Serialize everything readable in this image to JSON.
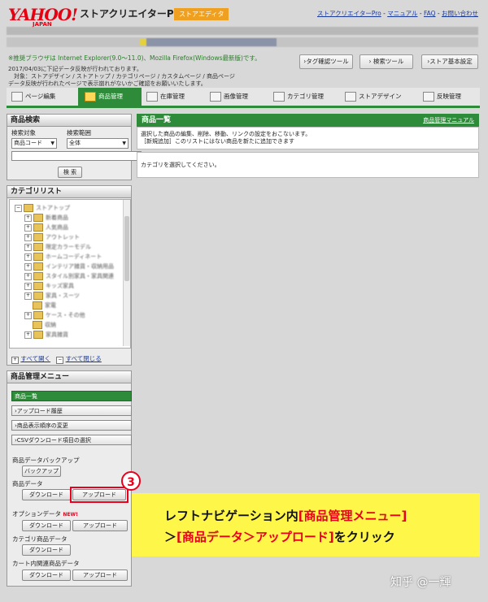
{
  "header": {
    "logo_text": "YAHOO!",
    "logo_sub": "JAPAN",
    "app_title": "ストアクリエイターPro",
    "store_badge": "ストアエディタ",
    "link_pro": "ストアクリエイターPro",
    "link_manual": "マニュアル",
    "link_faq": "FAQ",
    "link_contact": "お問い合わせ"
  },
  "notice": {
    "browser": "※推奨ブラウザは Internet Explorer(9.0〜11.0)、Mozilla Firefox(Windows最新版)です。",
    "line1": "2017/04/03に下記データ反映が行われております。",
    "line2": "　対象：ストアデザイン / ストアトップ / カテゴリページ / カスタムページ / 商品ページ",
    "line3": "データ反映が行われたページで表示崩れがないかご確認をお願いいたします。"
  },
  "toolbar": {
    "tag_tool": "›タグ確認ツール",
    "search_tool": "› 検索ツール",
    "store_settings": "›ストア基本設定"
  },
  "tabs": [
    {
      "label": "ページ編集"
    },
    {
      "label": "商品管理"
    },
    {
      "label": "在庫管理"
    },
    {
      "label": "画像管理"
    },
    {
      "label": "カテゴリ管理"
    },
    {
      "label": "ストアデザイン"
    },
    {
      "label": "反映管理"
    }
  ],
  "search_panel": {
    "title": "商品検索",
    "target_label": "検索対象",
    "range_label": "検索範囲",
    "target_value": "商品コード",
    "range_value": "全体",
    "search_button": "検 索"
  },
  "category_panel": {
    "title": "カテゴリリスト",
    "root": "ストアトップ",
    "items": [
      "新着商品",
      "人気商品",
      "アウトレット",
      "限定カラーモデル",
      "ホームコーディネート",
      "インテリア雑貨・収納用品",
      "スタイル別家具・家具関連",
      "キッズ家具",
      "家具・スーツ",
      "家電",
      "ケース・その他",
      "収納",
      "家具雑貨"
    ],
    "expand_all": "すべて開く",
    "collapse_all": "すべて閉じる"
  },
  "menu_panel": {
    "title": "商品管理メニュー",
    "items": [
      "商品一覧",
      "›アップロード履歴",
      "›商品表示順序の変更",
      "›CSVダウンロード項目の選択"
    ],
    "backup_label": "商品データバックアップ",
    "backup_button": "バックアップ",
    "product_data_label": "商品データ",
    "download": "ダウンロード",
    "upload": "アップロード",
    "option_label": "オプションデータ",
    "new_badge": "NEW!",
    "category_product_label": "カテゴリ商品データ",
    "cart_label": "カート内関連商品データ"
  },
  "main": {
    "title": "商品一覧",
    "manual_link": "商品管理マニュアル",
    "desc1": "選択した商品の編集、削除、移動、リンクの設定をおこないます。",
    "desc2": "［新規追加］このリストにはない商品を新たに追加できます",
    "empty": "カテゴリを選択してください。"
  },
  "callout": {
    "step": "3",
    "l1_a": "レフトナビゲーション内",
    "l1_b": "[商品管理メニュー]",
    "l2_a": "＞",
    "l2_b": "[商品データ＞アップロード]",
    "l2_c": "をクリック"
  },
  "watermark": "知乎 @一輝"
}
